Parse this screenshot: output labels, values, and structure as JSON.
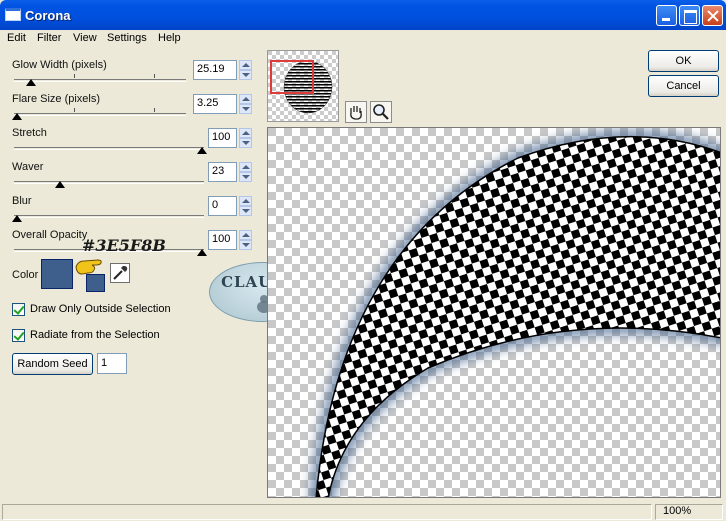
{
  "window": {
    "title": "Corona",
    "icon": "window-icon"
  },
  "menu": [
    "Edit",
    "Filter",
    "View",
    "Settings",
    "Help"
  ],
  "controls": [
    {
      "label": "Glow Width (pixels)",
      "value": "25.19",
      "level": 0.12
    },
    {
      "label": "Flare Size (pixels)",
      "value": "3.25",
      "level": 0.02
    },
    {
      "label": "Stretch",
      "value": "100",
      "level": 1.0
    },
    {
      "label": "Waver",
      "value": "23",
      "level": 0.23
    },
    {
      "label": "Blur",
      "value": "0",
      "level": 0.0
    },
    {
      "label": "Overall Opacity",
      "value": "100",
      "level": 1.0
    }
  ],
  "color": {
    "label": "Color",
    "swatch": "#3E5F8B",
    "annotation": "#3E5F8B"
  },
  "checkboxes": [
    {
      "label": "Draw Only Outside Selection",
      "checked": true
    },
    {
      "label": "Radiate from the Selection",
      "checked": true
    }
  ],
  "random_seed": {
    "label": "Random Seed",
    "value": "1"
  },
  "watermark": "CLAUDIA",
  "buttons": {
    "ok": "OK",
    "cancel": "Cancel"
  },
  "tools": [
    "hand-icon",
    "magnifier-icon"
  ],
  "status": {
    "zoom": "100%"
  },
  "colors": {
    "titlebar": "#0053E1",
    "face": "#ECE9D8",
    "glow": "#3E5F8B",
    "selection_box": "#E03B3B"
  }
}
